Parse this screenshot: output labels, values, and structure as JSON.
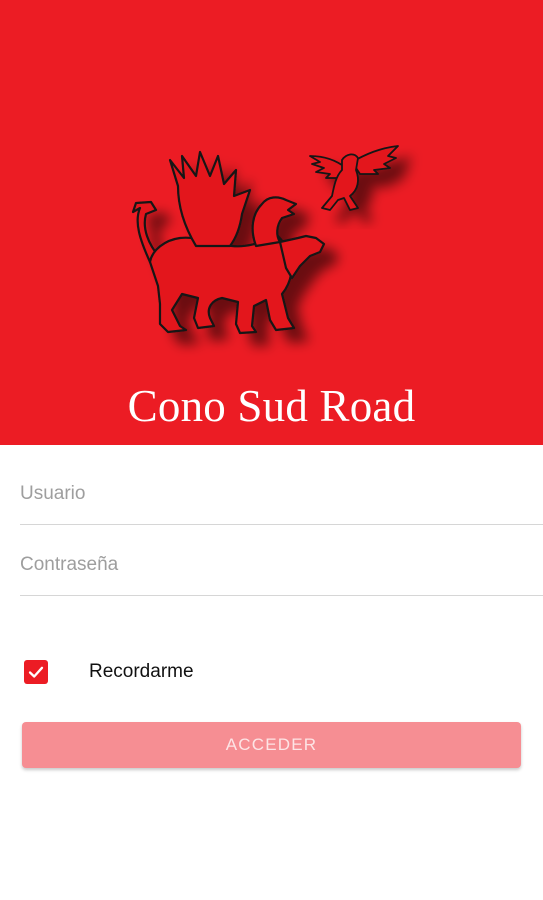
{
  "app": {
    "title": "Cono Sud Road",
    "logo_icon": "griffin-logo-icon"
  },
  "form": {
    "username_placeholder": "Usuario",
    "username_value": "",
    "password_placeholder": "Contraseña",
    "password_value": "",
    "remember_label": "Recordarme",
    "remember_checked": true,
    "submit_label": "ACCEDER"
  },
  "colors": {
    "brand": "#ec1c24",
    "button_disabled": "#f68e93",
    "button_text": "#fde4e5"
  }
}
